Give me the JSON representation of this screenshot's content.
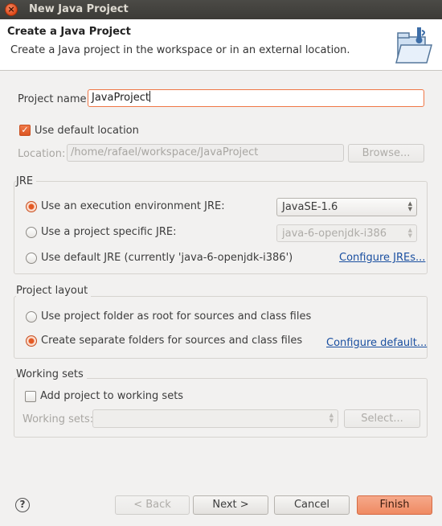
{
  "window": {
    "title": "New Java Project",
    "close_glyph": "×"
  },
  "banner": {
    "title": "Create a Java Project",
    "description": "Create a Java project in the workspace or in an external location.",
    "icon": "folder-icon"
  },
  "project": {
    "name_label": "Project name:",
    "name_value": "JavaProject"
  },
  "location": {
    "use_default_label": "Use default location",
    "use_default_checked": true,
    "label": "Location:",
    "value": "/home/rafael/workspace/JavaProject",
    "browse_label": "Browse..."
  },
  "jre": {
    "group_title": "JRE",
    "options": [
      {
        "label": "Use an execution environment JRE:",
        "checked": true
      },
      {
        "label": "Use a project specific JRE:",
        "checked": false
      },
      {
        "label": "Use default JRE (currently 'java-6-openjdk-i386')",
        "checked": false
      }
    ],
    "env_selected": "JavaSE-1.6",
    "specific_selected": "java-6-openjdk-i386",
    "configure_link": "Configure JREs..."
  },
  "layout": {
    "group_title": "Project layout",
    "options": [
      {
        "label": "Use project folder as root for sources and class files",
        "checked": false
      },
      {
        "label": "Create separate folders for sources and class files",
        "checked": true
      }
    ],
    "configure_link": "Configure default..."
  },
  "working_sets": {
    "group_title": "Working sets",
    "add_label": "Add project to working sets",
    "add_checked": false,
    "sets_label": "Working sets:",
    "sets_value": "",
    "select_label": "Select..."
  },
  "footer": {
    "help_glyph": "?",
    "back_label": "< Back",
    "next_label": "Next >",
    "cancel_label": "Cancel",
    "finish_label": "Finish"
  },
  "colors": {
    "accent": "#f07746",
    "link": "#1a4fa0",
    "titlebar": "#3c3b37"
  }
}
